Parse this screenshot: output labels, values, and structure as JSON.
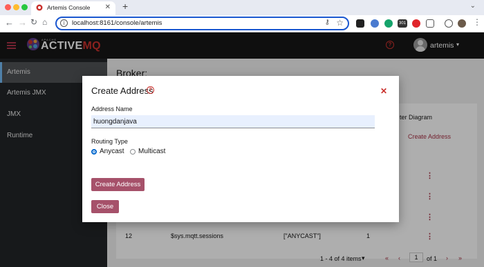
{
  "browser": {
    "tab_title": "Artemis Console",
    "new_tab": "+",
    "url": "localhost:8161/console/artemis",
    "ext_badge": "301"
  },
  "app": {
    "logo_small": "APACHE",
    "logo_main": "ACTIVE",
    "logo_mq": "MQ",
    "username": "artemis",
    "colors": {
      "accent": "#a83246",
      "masthead": "#151515",
      "sidebar": "#212427"
    }
  },
  "sidebar": {
    "items": [
      {
        "label": "Artemis"
      },
      {
        "label": "Artemis JMX"
      },
      {
        "label": "JMX"
      },
      {
        "label": "Runtime"
      }
    ]
  },
  "main": {
    "title": "Broker:",
    "column_header": "ter Diagram",
    "create_address_link": "Create Address",
    "row": {
      "id": "12",
      "name": "$sys.mqtt.sessions",
      "routing": "[\"ANYCAST\"]",
      "count": "1"
    },
    "pager": {
      "range": "1 - 4 of 4 items",
      "page": "1",
      "of": "of 1"
    }
  },
  "modal": {
    "title": "Create Address",
    "name_label": "Address Name",
    "name_value": "huongdanjava",
    "routing_label": "Routing Type",
    "options": [
      {
        "label": "Anycast",
        "selected": true
      },
      {
        "label": "Multicast",
        "selected": false
      }
    ],
    "create_button": "Create Address",
    "close_button": "Close"
  }
}
